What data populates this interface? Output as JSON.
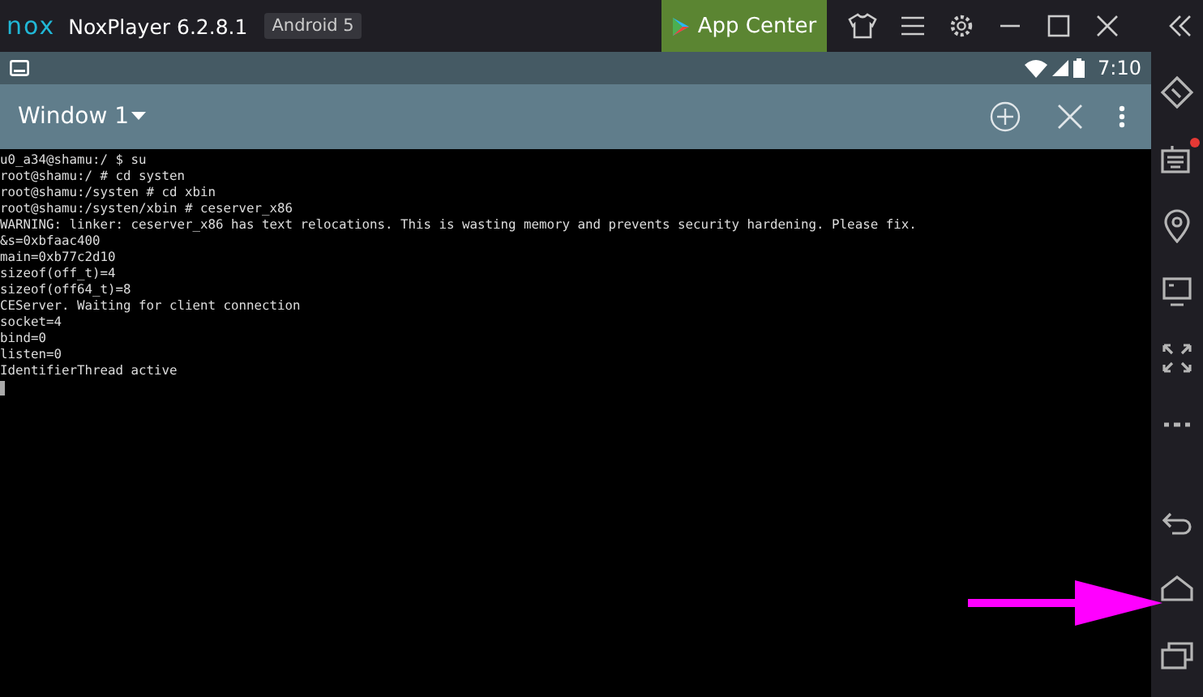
{
  "title_bar": {
    "logo": "nox",
    "title": "NoxPlayer 6.2.8.1",
    "badge": "Android 5",
    "app_center": "App Center"
  },
  "status_bar": {
    "time": "7:10"
  },
  "app_bar": {
    "title": "Window 1"
  },
  "terminal": {
    "lines": [
      "u0_a34@shamu:/ $ su",
      "root@shamu:/ # cd systen",
      "root@shamu:/systen # cd xbin",
      "root@shamu:/systen/xbin # ceserver_x86",
      "WARNING: linker: ceserver_x86 has text relocations. This is wasting memory and prevents security hardening. Please fix.",
      "&s=0xbfaac400",
      "main=0xb77c2d10",
      "sizeof(off_t)=4",
      "sizeof(off64_t)=8",
      "CEServer. Waiting for client connection",
      "socket=4",
      "bind=0",
      "listen=0",
      "IdentifierThread active"
    ]
  },
  "sidebar": {
    "items": [
      {
        "kind": "rotate",
        "notification": false
      },
      {
        "kind": "keyboard",
        "notification": true
      },
      {
        "kind": "location",
        "notification": false
      },
      {
        "kind": "screen",
        "notification": false
      },
      {
        "kind": "expand",
        "notification": false
      },
      {
        "kind": "more",
        "notification": false
      },
      {
        "kind": "back",
        "notification": false
      },
      {
        "kind": "home",
        "notification": false
      },
      {
        "kind": "recents",
        "notification": false
      }
    ]
  }
}
